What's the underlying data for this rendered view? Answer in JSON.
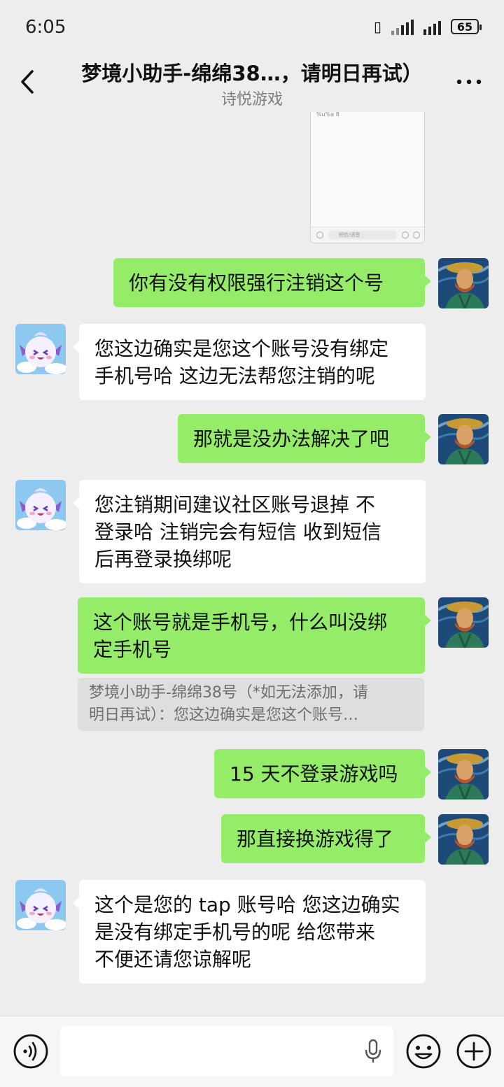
{
  "status_bar": {
    "time": "6:05",
    "battery": "65"
  },
  "header": {
    "title": "梦境小助手-绵绵38…，请明日再试）",
    "subtitle": "诗悦游戏"
  },
  "screenshot_preview": {
    "tiny_text": "%u%a 8",
    "input_hint": "短信/语音"
  },
  "messages": [
    {
      "from": "me",
      "lines": [
        "你有没有权限强行注销这个号"
      ]
    },
    {
      "from": "other",
      "lines": [
        "您这边确实是您这个账号没有绑定",
        "手机号哈 这边无法帮您注销的呢"
      ]
    },
    {
      "from": "me",
      "lines": [
        "那就是没办法解决了吧"
      ]
    },
    {
      "from": "other",
      "lines": [
        "您注销期间建议社区账号退掉 不",
        "登录哈 注销完会有短信 收到短信",
        "后再登录换绑呢"
      ]
    },
    {
      "from": "me",
      "lines": [
        "这个账号就是手机号，什么叫没绑",
        "定手机号"
      ]
    },
    {
      "from": "me",
      "lines": [
        "15 天不登录游戏吗"
      ]
    },
    {
      "from": "me",
      "lines": [
        "那直接换游戏得了"
      ]
    },
    {
      "from": "other",
      "lines": [
        "这个是您的 tap 账号哈 您这边确实",
        "是没有绑定手机号的呢 给您带来",
        "不便还请您谅解呢"
      ]
    }
  ],
  "quote": {
    "lines": [
      "梦境小助手-绵绵38号（*如无法添加，请",
      "明日再试）：您这边确实是您这个账号…"
    ]
  },
  "input_bar": {
    "voice_icon": "voice-icon",
    "mic_icon": "microphone-icon",
    "emoji_icon": "emoji-icon",
    "plus_icon": "plus-icon"
  },
  "colors": {
    "background": "#ededed",
    "my_bubble": "#95ec69",
    "their_bubble": "#ffffff"
  }
}
